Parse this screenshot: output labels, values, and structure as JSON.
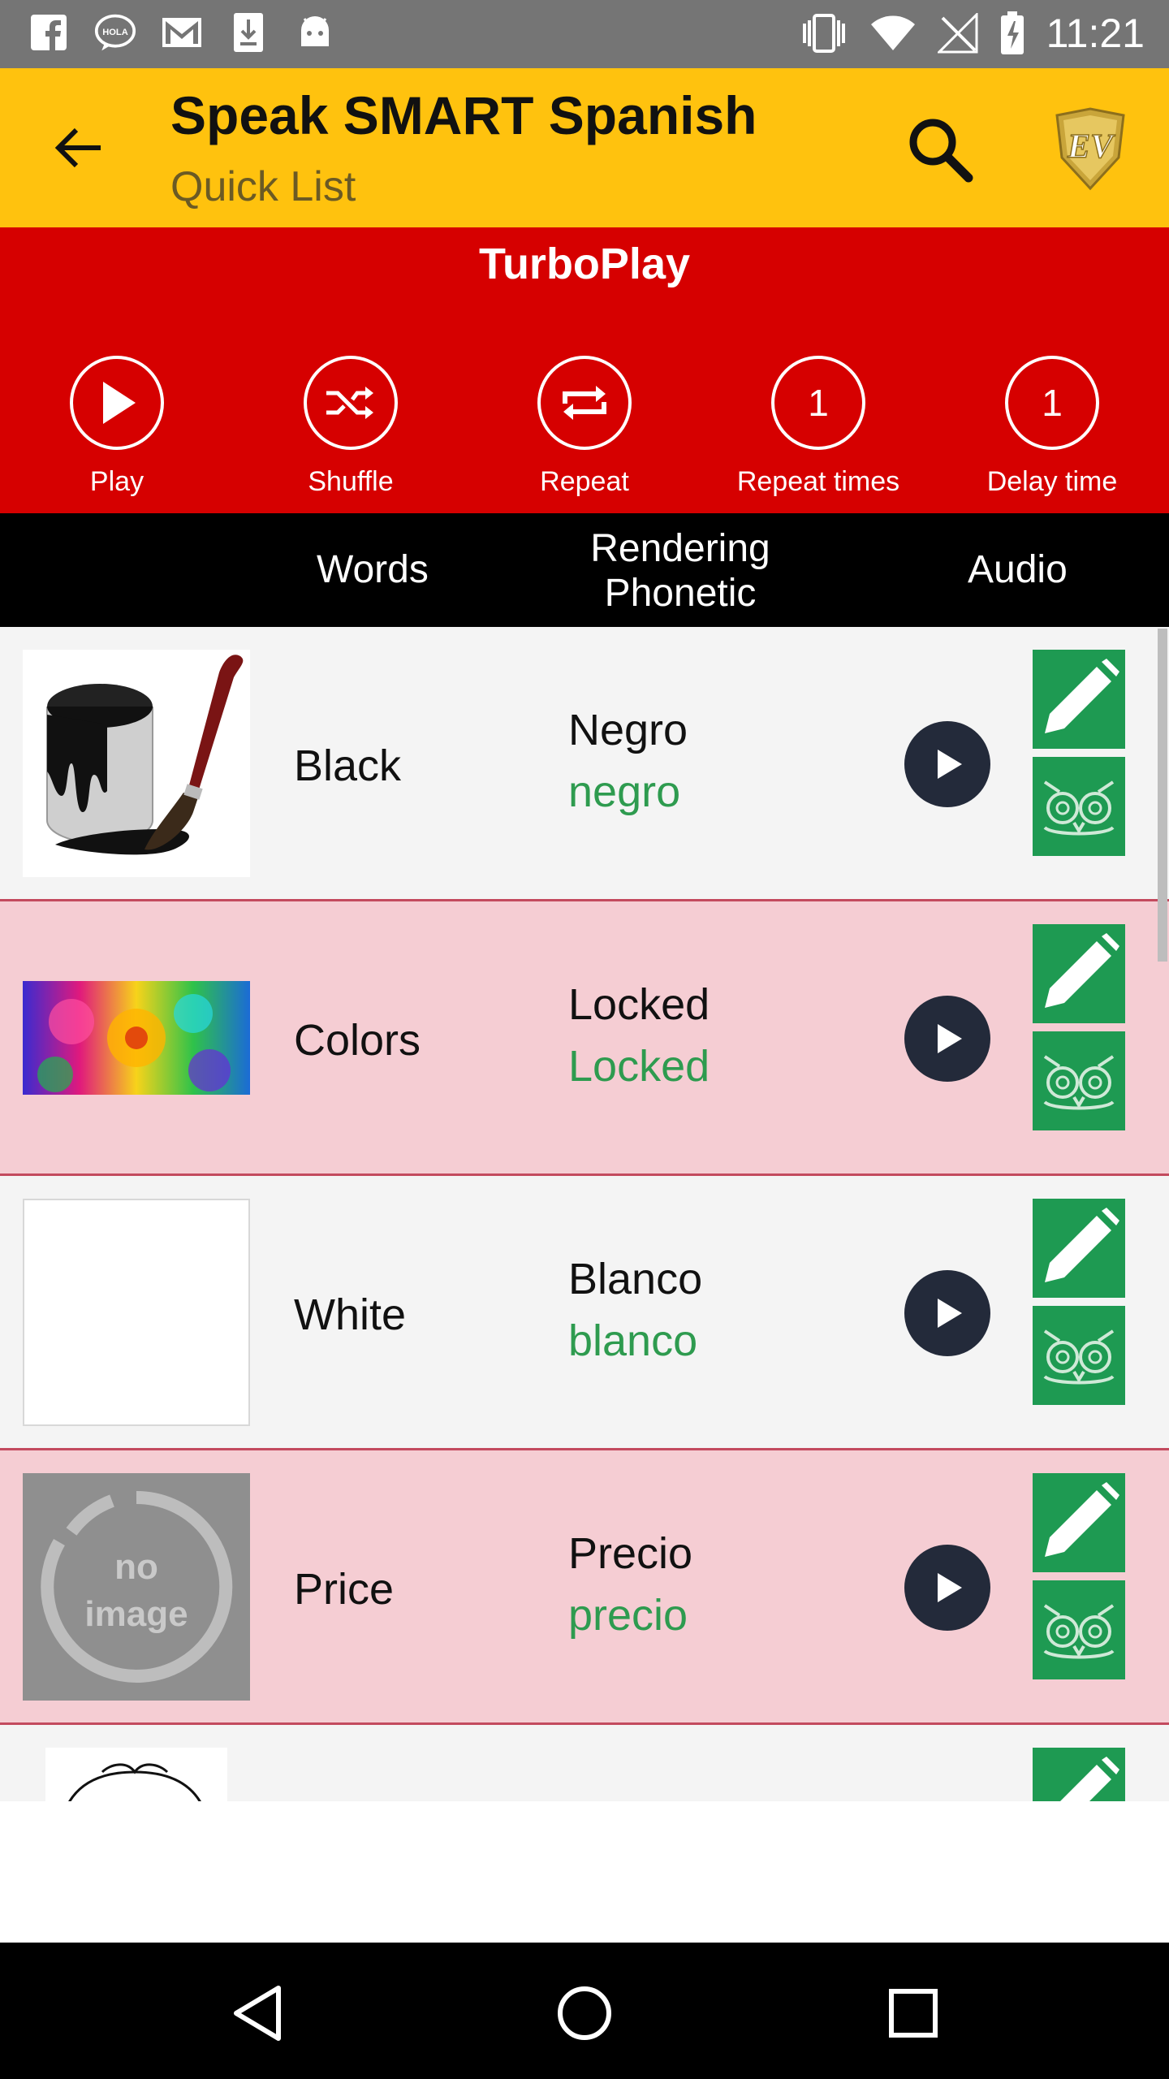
{
  "status_bar": {
    "time": "11:21",
    "left_icons": [
      "facebook-icon",
      "hola-chat-icon",
      "gmail-icon",
      "download-icon",
      "android-icon"
    ],
    "right_icons": [
      "vibrate-icon",
      "wifi-icon",
      "no-signal-icon",
      "battery-charging-icon"
    ]
  },
  "toolbar": {
    "title": "Speak SMART Spanish",
    "subtitle": "Quick List",
    "back_icon": "arrow-back-icon",
    "search_icon": "search-icon",
    "logo": "ev-shield-logo"
  },
  "turboplay": {
    "title": "TurboPlay",
    "controls": [
      {
        "label": "Play",
        "icon": "play-icon"
      },
      {
        "label": "Shuffle",
        "icon": "shuffle-icon"
      },
      {
        "label": "Repeat",
        "icon": "repeat-icon"
      },
      {
        "label": "Repeat times",
        "value": "1"
      },
      {
        "label": "Delay time",
        "value": "1"
      }
    ]
  },
  "columns": {
    "words": "Words",
    "rendering_line1": "Rendering",
    "rendering_line2": "Phonetic",
    "audio": "Audio"
  },
  "rows": [
    {
      "word": "Black",
      "rendering": "Negro",
      "phonetic": "negro",
      "image": "paint-can-brush"
    },
    {
      "word": "Colors",
      "rendering": "Locked",
      "phonetic": "Locked",
      "image": "colorful-flowers"
    },
    {
      "word": "White",
      "rendering": "Blanco",
      "phonetic": "blanco",
      "image": "white-blank"
    },
    {
      "word": "Price",
      "rendering": "Precio",
      "phonetic": "precio",
      "image": "no-image"
    }
  ],
  "placeholder": {
    "no_image_line1": "no",
    "no_image_line2": "image"
  },
  "colors": {
    "toolbar": "#FFC20E",
    "turbo": "#D60000",
    "row_even": "#f4f4f4",
    "row_odd": "#f5cdd3",
    "action_green": "#1e9a52",
    "phonetic_green": "#2e9b4f"
  }
}
